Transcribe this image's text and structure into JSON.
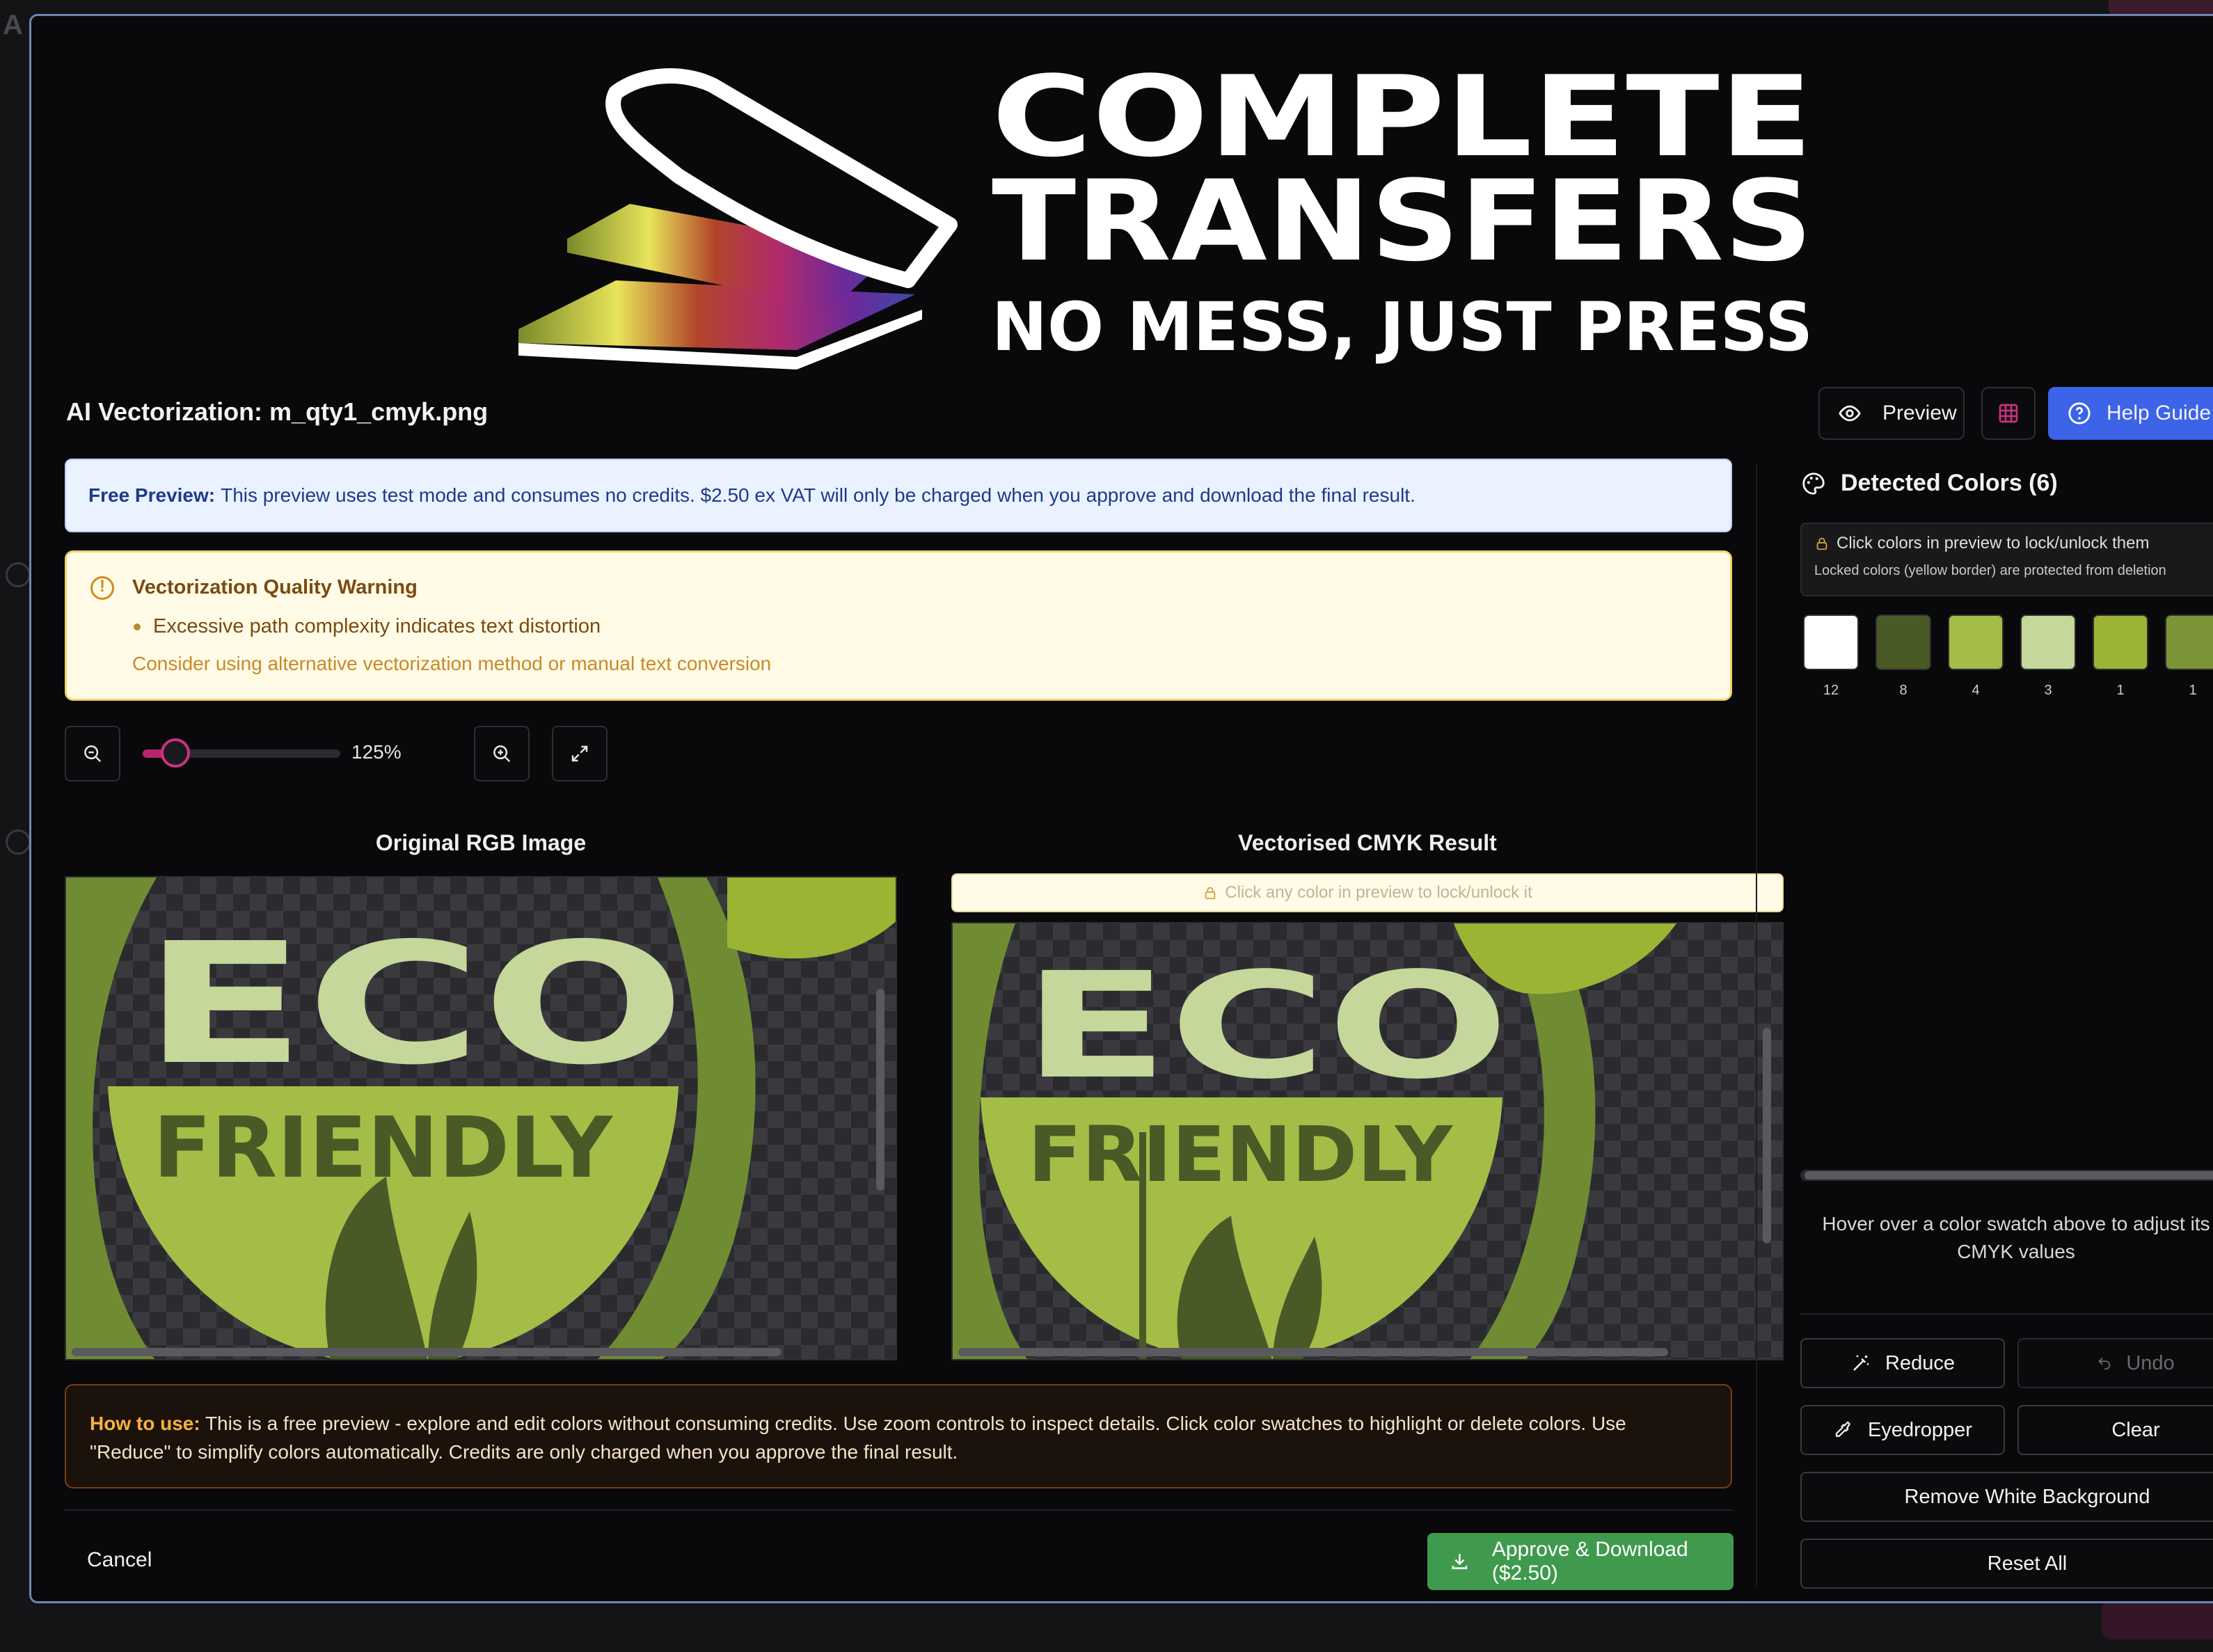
{
  "background_page": {
    "title_fragment": "A"
  },
  "banner": {
    "brand_line1": "COMPLETE",
    "brand_line2": "TRANSFERS",
    "tagline": "NO MESS, JUST PRESS"
  },
  "modal": {
    "title": "AI Vectorization: m_qty1_cmyk.png",
    "header_buttons": {
      "preview_label": "Preview",
      "help_label": "Help Guide"
    },
    "free_preview": {
      "label": "Free Preview:",
      "text": "This preview uses test mode and consumes no credits. $2.50 ex VAT will only be charged when you approve and download the final result."
    },
    "warning": {
      "title": "Vectorization Quality Warning",
      "bullet": "Excessive path complexity indicates text distortion",
      "note": "Consider using alternative vectorization method or manual text conversion"
    },
    "zoom": {
      "value_label": "125%",
      "level": 0.125
    },
    "original_panel": {
      "title": "Original RGB Image"
    },
    "result_panel": {
      "title": "Vectorised CMYK Result",
      "hint": "Click any color in preview to lock/unlock it"
    },
    "artwork": {
      "word1": "ECO",
      "word2": "FRIENDLY"
    },
    "how_to": {
      "label": "How to use:",
      "text": "This is a free preview - explore and edit colors without consuming credits. Use zoom controls to inspect details. Click color swatches to highlight or delete colors. Use \"Reduce\" to simplify colors automatically. Credits are only charged when you approve the final result."
    },
    "footer": {
      "cancel_label": "Cancel",
      "approve_label": "Approve & Download ($2.50)"
    }
  },
  "detected_colors": {
    "title": "Detected Colors (6)",
    "lock_info_line1": "Click colors in preview to lock/unlock them",
    "lock_info_line2": "Locked colors (yellow border) are protected from deletion",
    "swatches": [
      {
        "color": "#ffffff",
        "count": "12"
      },
      {
        "color": "#4a5a26",
        "count": "8"
      },
      {
        "color": "#a3bd47",
        "count": "4"
      },
      {
        "color": "#c5d79a",
        "count": "3"
      },
      {
        "color": "#9bb434",
        "count": "1"
      },
      {
        "color": "#7a9436",
        "count": "1"
      }
    ],
    "hover_message": "Hover over a color swatch above to adjust its CMYK values",
    "buttons": {
      "reduce": "Reduce",
      "undo": "Undo",
      "eyedropper": "Eyedropper",
      "clear": "Clear",
      "remove_white": "Remove White Background",
      "reset_all": "Reset All"
    }
  },
  "colors": {
    "accent_blue": "#3c63e8",
    "approve_green": "#3f9a4e",
    "slider_pink": "#c9337d",
    "warning_border": "#f1d56a"
  }
}
